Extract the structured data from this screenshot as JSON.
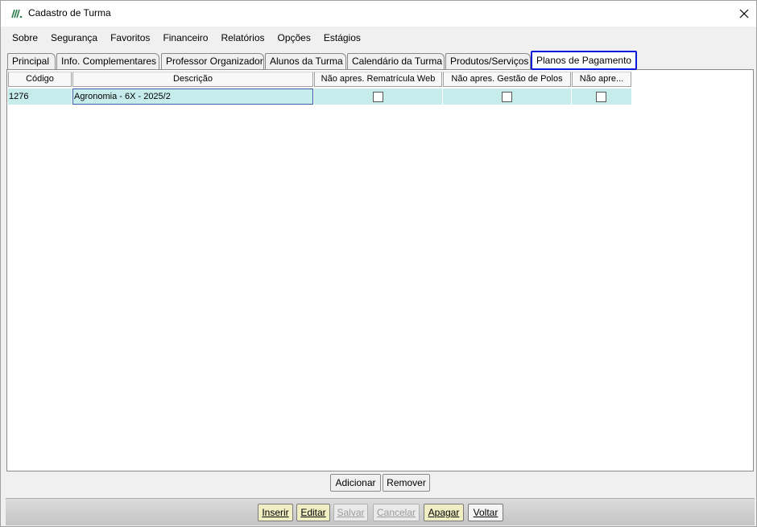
{
  "window": {
    "title": "Cadastro de Turma"
  },
  "menu": [
    "Sobre",
    "Segurança",
    "Favoritos",
    "Financeiro",
    "Relatórios",
    "Opções",
    "Estágios"
  ],
  "tabs": [
    {
      "label": "Principal"
    },
    {
      "label": "Info. Complementares"
    },
    {
      "label": "Professor Organizador"
    },
    {
      "label": "Alunos da Turma"
    },
    {
      "label": "Calendário da Turma"
    },
    {
      "label": "Produtos/Serviços"
    },
    {
      "label": "Planos de Pagamento",
      "active": true
    }
  ],
  "grid": {
    "columns": [
      "Código",
      "Descrição",
      "Não apres. Rematrícula Web",
      "Não apres. Gestão de Polos",
      "Não apre..."
    ],
    "rows": [
      {
        "codigo": "1276",
        "descricao": "Agronomia - 6X - 2025/2",
        "rematricula_web": false,
        "gestao_polos": false,
        "nao_apre": false
      }
    ]
  },
  "grid_buttons": {
    "add": "Adicionar",
    "remove": "Remover"
  },
  "footer_buttons": [
    {
      "label": "Inserir",
      "state": "enabled"
    },
    {
      "label": "Editar",
      "state": "enabled"
    },
    {
      "label": "Salvar",
      "state": "disabled"
    },
    {
      "label": "Cancelar",
      "state": "disabled"
    },
    {
      "label": "Apagar",
      "state": "enabled"
    },
    {
      "label": "Voltar",
      "state": "enabled"
    }
  ],
  "colors": {
    "active_tab_border": "#0a1ad8",
    "selected_row": "#c7ecec",
    "highlight_button": "#f2eec4"
  },
  "icons": {
    "app": "app-logo-icon",
    "close": "close-icon"
  }
}
